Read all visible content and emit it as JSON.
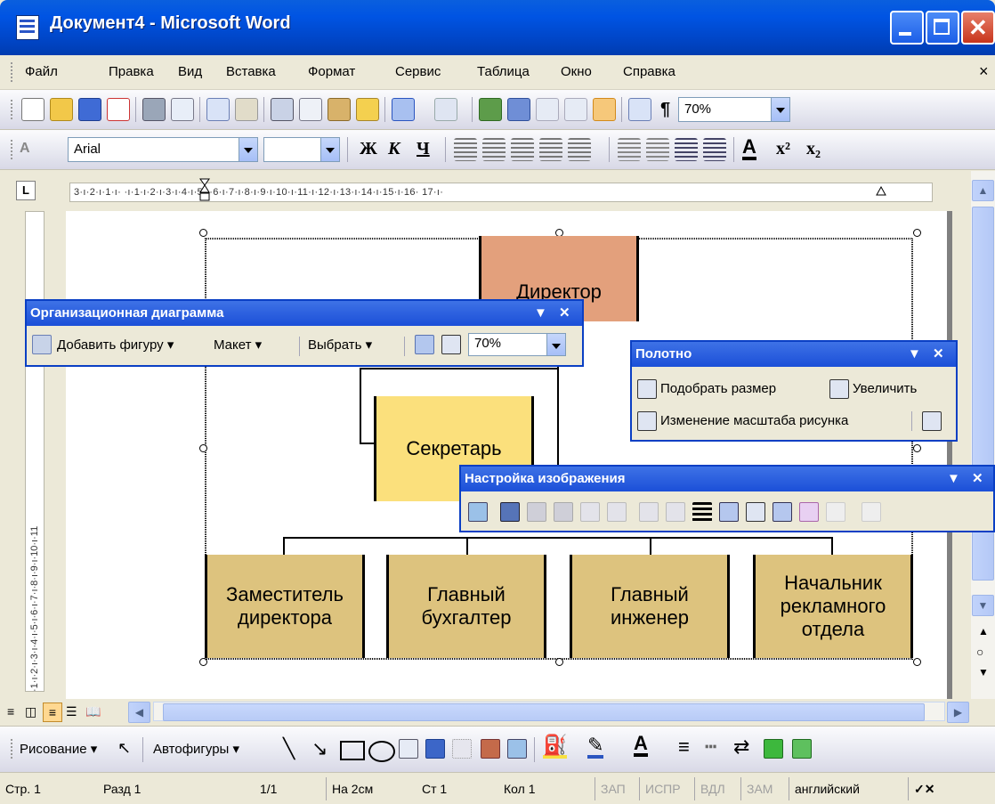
{
  "window": {
    "title": "Документ4 - Microsoft Word"
  },
  "menu": {
    "items": [
      "Файл",
      "Правка",
      "Вид",
      "Вставка",
      "Формат",
      "Сервис",
      "Таблица",
      "Окно",
      "Справка"
    ],
    "close": "×"
  },
  "standard_toolbar": {
    "zoom": "70%"
  },
  "format_toolbar": {
    "font": "Arial",
    "size": "",
    "bold": "Ж",
    "italic": "К",
    "underline": "Ч",
    "pilcrow": "¶"
  },
  "ruler": {
    "tab_selector": "L",
    "h_marks": "3·ı·2·ı·1·ı·  ·ı·1·ı·2·ı·3·ı·4·ı·5·ı·6·ı·7·ı·8·ı·9·ı·10·ı·11·ı·12·ı·13·ı·14·ı·15·ı·16·  17·ı·",
    "v_marks": "·1·ı·2·ı·3·ı·4·ı·5·ı·6·ı·7·ı·8·ı·9·ı·10·ı·11"
  },
  "org_chart": {
    "director": "Директор",
    "secretary": "Секретарь",
    "subordinates": [
      {
        "line1": "Заместитель",
        "line2": "директора"
      },
      {
        "line1": "Главный",
        "line2": "бухгалтер"
      },
      {
        "line1": "Главный",
        "line2": "инженер"
      },
      {
        "line1": "Начальник",
        "line2": "рекламного",
        "line3": "отдела"
      }
    ],
    "colors": {
      "director": "#e3a07c",
      "secretary": "#fbe07c",
      "subordinate": "#ddc37e"
    }
  },
  "orgchart_toolbar": {
    "title": "Организационная диаграмма",
    "add_shape": "Добавить фигуру",
    "layout": "Макет",
    "select": "Выбрать",
    "zoom": "70%"
  },
  "canvas_toolbar": {
    "title": "Полотно",
    "fit": "Подобрать размер",
    "expand": "Увеличить",
    "scale": "Изменение масштаба рисунка"
  },
  "picture_toolbar": {
    "title": "Настройка изображения"
  },
  "drawing_toolbar": {
    "draw": "Рисование",
    "autoshapes": "Автофигуры"
  },
  "status": {
    "page": "Стр. 1",
    "section": "Разд 1",
    "pages": "1/1",
    "at": "На 2см",
    "line": "Ст 1",
    "col": "Кол 1",
    "rec": "ЗАП",
    "trk": "ИСПР",
    "ext": "ВДЛ",
    "ovr": "ЗАМ",
    "lang": "английский"
  }
}
